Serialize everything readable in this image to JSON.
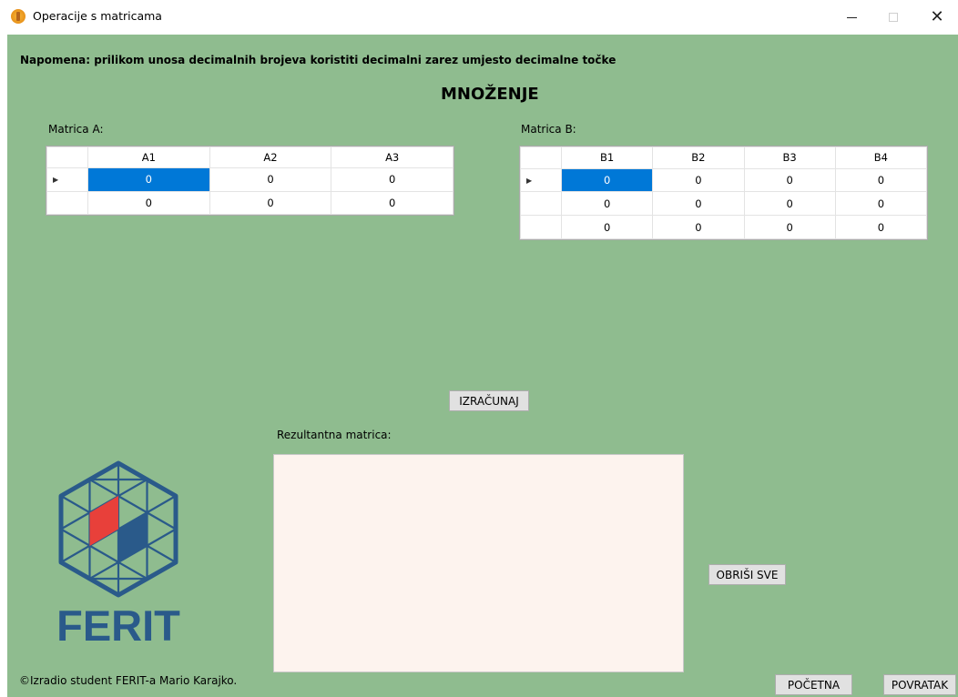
{
  "window": {
    "title": "Operacije s matricama"
  },
  "note": "Napomena: prilikom unosa decimalnih brojeva koristiti decimalni zarez umjesto decimalne točke",
  "heading": "MNOŽENJE",
  "matrix_a": {
    "label": "Matrica A:",
    "columns": [
      "A1",
      "A2",
      "A3"
    ],
    "rows": [
      [
        "0",
        "0",
        "0"
      ],
      [
        "0",
        "0",
        "0"
      ]
    ]
  },
  "matrix_b": {
    "label": "Matrica B:",
    "columns": [
      "B1",
      "B2",
      "B3",
      "B4"
    ],
    "rows": [
      [
        "0",
        "0",
        "0",
        "0"
      ],
      [
        "0",
        "0",
        "0",
        "0"
      ],
      [
        "0",
        "0",
        "0",
        "0"
      ]
    ]
  },
  "buttons": {
    "calculate": "IZRAČUNAJ",
    "clear_all": "OBRIŠI SVE",
    "home": "POČETNA",
    "back": "POVRATAK"
  },
  "result": {
    "label": "Rezultantna matrica:",
    "value": ""
  },
  "logo": {
    "text": "FERIT",
    "colors": {
      "primary": "#2a5a8a",
      "accent": "#e8403a"
    }
  },
  "footer": "©Izradio student FERIT-a Mario Karajko.",
  "colors": {
    "background": "#8fbc8f",
    "selection": "#0078d7",
    "result_bg": "#fdf3ee"
  }
}
